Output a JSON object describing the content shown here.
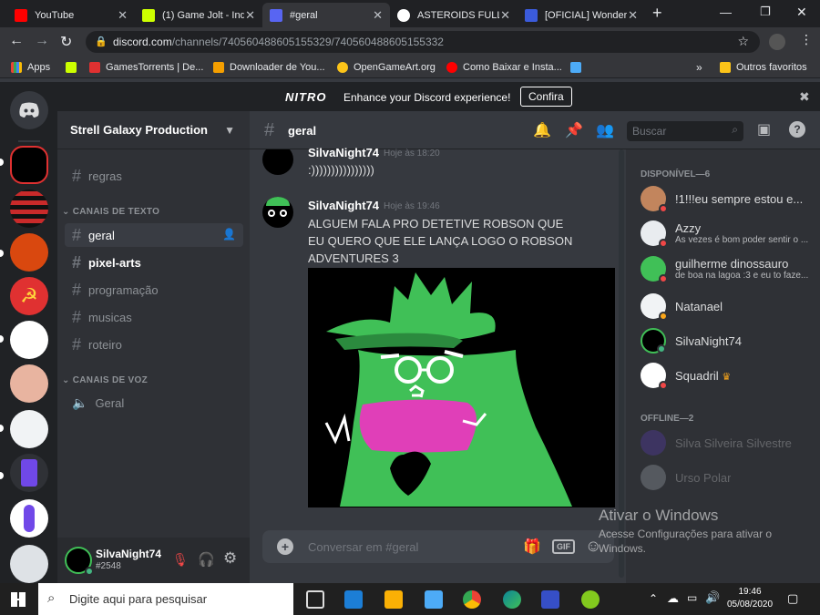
{
  "browser": {
    "tabs": [
      {
        "label": "YouTube",
        "color": "#ff0000"
      },
      {
        "label": "(1) Game Jolt - Ind",
        "color": "#ccff00"
      },
      {
        "label": "#geral",
        "color": "#5865f2"
      },
      {
        "label": "ASTEROIDS FULL",
        "color": "#ffffff"
      },
      {
        "label": "[OFICIAL] Wonder",
        "color": "#3b5bdb"
      }
    ],
    "url_domain": "discord.com",
    "url_path": "/channels/740560488605155329/740560488605155332",
    "bookmarks": [
      {
        "label": "Apps",
        "color": "#e8eaed"
      },
      {
        "label": "",
        "color": "#ccff00"
      },
      {
        "label": "GamesTorrents | De...",
        "color": "#e03131"
      },
      {
        "label": "Downloader de You...",
        "color": "#f59f00"
      },
      {
        "label": "OpenGameArt.org",
        "color": "#fcc419"
      },
      {
        "label": "Como Baixar e Insta...",
        "color": "#ff0000"
      },
      {
        "label": "",
        "color": "#4dabf7"
      }
    ],
    "bookmarks_other": "Outros favoritos"
  },
  "nitro": {
    "logo": "NITRO",
    "text": "Enhance your Discord experience!",
    "button": "Confira"
  },
  "server": {
    "name": "Strell Galaxy Production",
    "top_channel": "regras",
    "text_category": "CANAIS DE TEXTO",
    "text_channels": [
      "geral",
      "pixel-arts",
      "programação",
      "musicas",
      "roteiro"
    ],
    "voice_category": "CANAIS DE VOZ",
    "voice_channels": [
      "Geral"
    ]
  },
  "user": {
    "name": "SilvaNight74",
    "tag": "#2548"
  },
  "chat": {
    "channel": "geral",
    "search_placeholder": "Buscar",
    "messages": [
      {
        "author": "SilvaNight74",
        "time": "Hoje às 18:20",
        "text": ":))))))))))))))))"
      },
      {
        "author": "SilvaNight74",
        "time": "Hoje às 19:46",
        "text": "ALGUEM FALA PRO DETETIVE ROBSON QUE EU QUERO QUE ELE LANÇA LOGO O ROBSON ADVENTURES 3"
      }
    ],
    "input_placeholder": "Conversar em #geral",
    "gif_label": "GIF"
  },
  "members": {
    "online_header": "DISPONÍVEL—6",
    "online": [
      {
        "name": "!1!!!eu sempre estou e...",
        "status": "",
        "dot": "#f04747"
      },
      {
        "name": "Azzy",
        "status": "Às vezes é bom poder sentir o ...",
        "dot": "#f04747"
      },
      {
        "name": "guilherme dinossauro",
        "status": "de boa na lagoa :3 e eu to faze...",
        "dot": "#f04747"
      },
      {
        "name": "Natanael",
        "status": "",
        "dot": "#faa61a"
      },
      {
        "name": "SilvaNight74",
        "status": "",
        "dot": "#43b581"
      },
      {
        "name": "Squadril",
        "status": "",
        "dot": "#f04747"
      }
    ],
    "offline_header": "OFFLINE—2",
    "offline": [
      {
        "name": "Silva Silveira Silvestre"
      },
      {
        "name": "Urso Polar"
      }
    ]
  },
  "watermark": {
    "title": "Ativar o Windows",
    "line1": "Acesse Configurações para ativar o",
    "line2": "Windows."
  },
  "taskbar": {
    "search_placeholder": "Digite aqui para pesquisar",
    "time": "19:46",
    "date": "05/08/2020"
  }
}
